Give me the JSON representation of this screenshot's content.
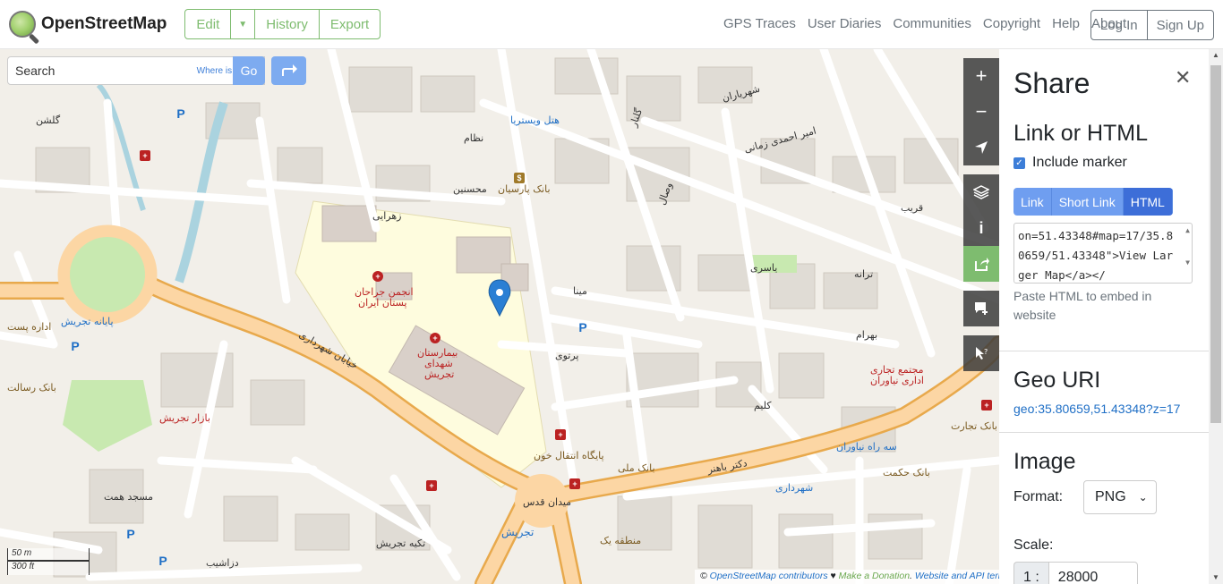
{
  "header": {
    "logo_text": "OpenStreetMap",
    "edit_label": "Edit",
    "history_label": "History",
    "export_label": "Export",
    "nav": [
      "GPS Traces",
      "User Diaries",
      "Communities",
      "Copyright",
      "Help",
      "About"
    ],
    "login_label": "Log In",
    "signup_label": "Sign Up"
  },
  "search": {
    "placeholder": "Search",
    "where_label": "Where is this?",
    "go_label": "Go"
  },
  "map": {
    "controls": [
      "zoom-in",
      "zoom-out",
      "locate",
      "layers",
      "info",
      "share",
      "note",
      "query"
    ],
    "labels": [
      {
        "text": "انجمن جراحان",
        "cls": "red"
      },
      {
        "text": "پستان ایران",
        "cls": "red"
      },
      {
        "text": "بیمارستان",
        "cls": "red"
      },
      {
        "text": "شهدای",
        "cls": "red"
      },
      {
        "text": "تجریش",
        "cls": "red"
      },
      {
        "text": "بانک پارسیان",
        "cls": "brown"
      },
      {
        "text": "هتل ویستریا",
        "cls": "blue"
      },
      {
        "text": "پایانه تجریش",
        "cls": "blue"
      },
      {
        "text": "مجتمع تجاری",
        "cls": "red"
      },
      {
        "text": "اداری نیاوران",
        "cls": "red"
      },
      {
        "text": "سه راه نیاوران",
        "cls": "blue"
      },
      {
        "text": "شهرداری",
        "cls": "blue"
      },
      {
        "text": "بانک ملی",
        "cls": "brown"
      },
      {
        "text": "بانک حکمت",
        "cls": "brown"
      },
      {
        "text": "بانک تجارت",
        "cls": "brown"
      },
      {
        "text": "میدان قدس",
        "cls": ""
      },
      {
        "text": "تجریش",
        "cls": "blue"
      },
      {
        "text": "مسجد همت",
        "cls": ""
      },
      {
        "text": "تکیه تجریش",
        "cls": ""
      },
      {
        "text": "خیابان شهرداری",
        "cls": ""
      },
      {
        "text": "دکتر باهنر",
        "cls": ""
      },
      {
        "text": "زهرایی",
        "cls": ""
      },
      {
        "text": "محسنین",
        "cls": ""
      },
      {
        "text": "مینا",
        "cls": ""
      },
      {
        "text": "پرتوی",
        "cls": ""
      },
      {
        "text": "بهرام",
        "cls": ""
      },
      {
        "text": "یاسری",
        "cls": ""
      },
      {
        "text": "ترانه",
        "cls": ""
      },
      {
        "text": "قریب",
        "cls": ""
      },
      {
        "text": "نظام",
        "cls": ""
      },
      {
        "text": "کلیم",
        "cls": ""
      },
      {
        "text": "گلشن",
        "cls": ""
      },
      {
        "text": "امیر احمدی زمانی",
        "cls": ""
      },
      {
        "text": "شهریاران",
        "cls": ""
      },
      {
        "text": "اداره پست",
        "cls": "brown"
      },
      {
        "text": "پایگاه انتقال خون",
        "cls": "brown"
      },
      {
        "text": "بانک رسالت",
        "cls": "brown"
      },
      {
        "text": "منطقه یک",
        "cls": "brown"
      },
      {
        "text": "بازار تجریش",
        "cls": "red"
      },
      {
        "text": "دزاشیب",
        "cls": ""
      },
      {
        "text": "وصال",
        "cls": ""
      },
      {
        "text": "گلنار",
        "cls": ""
      }
    ],
    "scale_m": "50 m",
    "scale_ft": "300 ft",
    "attribution_prefix": "©",
    "attribution_link": "OpenStreetMap contributors",
    "attribution_heart": "♥",
    "attribution_donate": "Make a Donation",
    "attribution_dot": ".",
    "attribution_terms": "Website and API terms"
  },
  "share": {
    "title": "Share",
    "link_section": "Link or HTML",
    "include_marker": "Include marker",
    "tabs": [
      "Link",
      "Short Link",
      "HTML"
    ],
    "selected_tab": "HTML",
    "html_code": "on=51.43348#map=17/35.80659/51.43348\">View Larger Map</a></",
    "hint": "Paste HTML to embed in website",
    "geo_section": "Geo URI",
    "geo_uri": "geo:35.80659,51.43348?z=17",
    "image_section": "Image",
    "format_label": "Format:",
    "format_value": "PNG",
    "scale_label": "Scale:",
    "scale_prefix": "1 :",
    "scale_value": "28000"
  }
}
